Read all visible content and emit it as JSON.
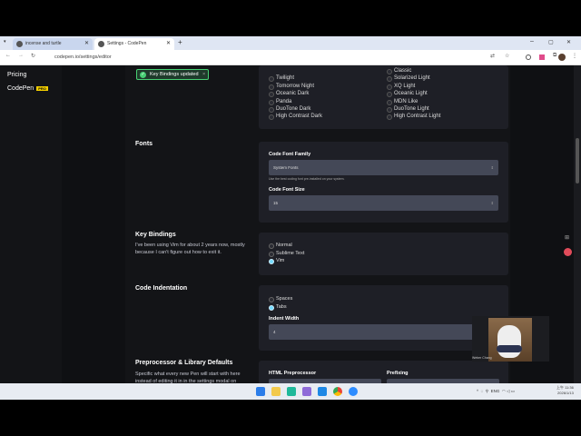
{
  "browser": {
    "tabs": [
      {
        "label": "incense and turtle"
      },
      {
        "label": "Settings - CodePen"
      }
    ],
    "url": "codepen.io/settings/editor",
    "window_controls": {
      "minimize": "–",
      "maximize": "▢",
      "close": "✕"
    }
  },
  "sidebar": {
    "items": [
      {
        "label": "Pricing"
      },
      {
        "label": "CodePen",
        "badge": "PRO"
      }
    ]
  },
  "toast": {
    "message": "Key Bindings updated",
    "close": "×"
  },
  "themes": {
    "left": [
      "Twilight",
      "Tomorrow Night",
      "Oceanic Dark",
      "Panda",
      "DuoTone Dark",
      "High Contrast Dark"
    ],
    "right": [
      "Classic",
      "Solarized Light",
      "XQ Light",
      "Oceanic Light",
      "MDN Like",
      "DuoTone Light",
      "High Contrast Light"
    ]
  },
  "fonts": {
    "title": "Fonts",
    "family_label": "Code Font Family",
    "family_value": "System Fonts",
    "family_hint": "Use the best coding font pre-installed on your system.",
    "size_label": "Code Font Size",
    "size_value": "15"
  },
  "key_bindings": {
    "title": "Key Bindings",
    "description": "I've been using Vim for about 2 years now, mostly because I can't figure out how to exit it.",
    "options": [
      "Normal",
      "Sublime Text",
      "Vim"
    ],
    "selected": "Vim"
  },
  "indentation": {
    "title": "Code Indentation",
    "options": [
      "Spaces",
      "Tabs"
    ],
    "selected": "Tabs",
    "width_label": "Indent Width",
    "width_value": "4"
  },
  "preprocessor": {
    "title": "Preprocessor & Library Defaults",
    "description": "Specific what every new Pen will start with here instead of editing it in in the settings modal on",
    "html_label": "HTML Preprocessor",
    "prefixing_label": "Prefixing"
  },
  "video": {
    "name": "Weber Chang"
  },
  "taskbar": {
    "language": "ENG",
    "time": "上午 11:36",
    "date": "2026/1/13"
  }
}
